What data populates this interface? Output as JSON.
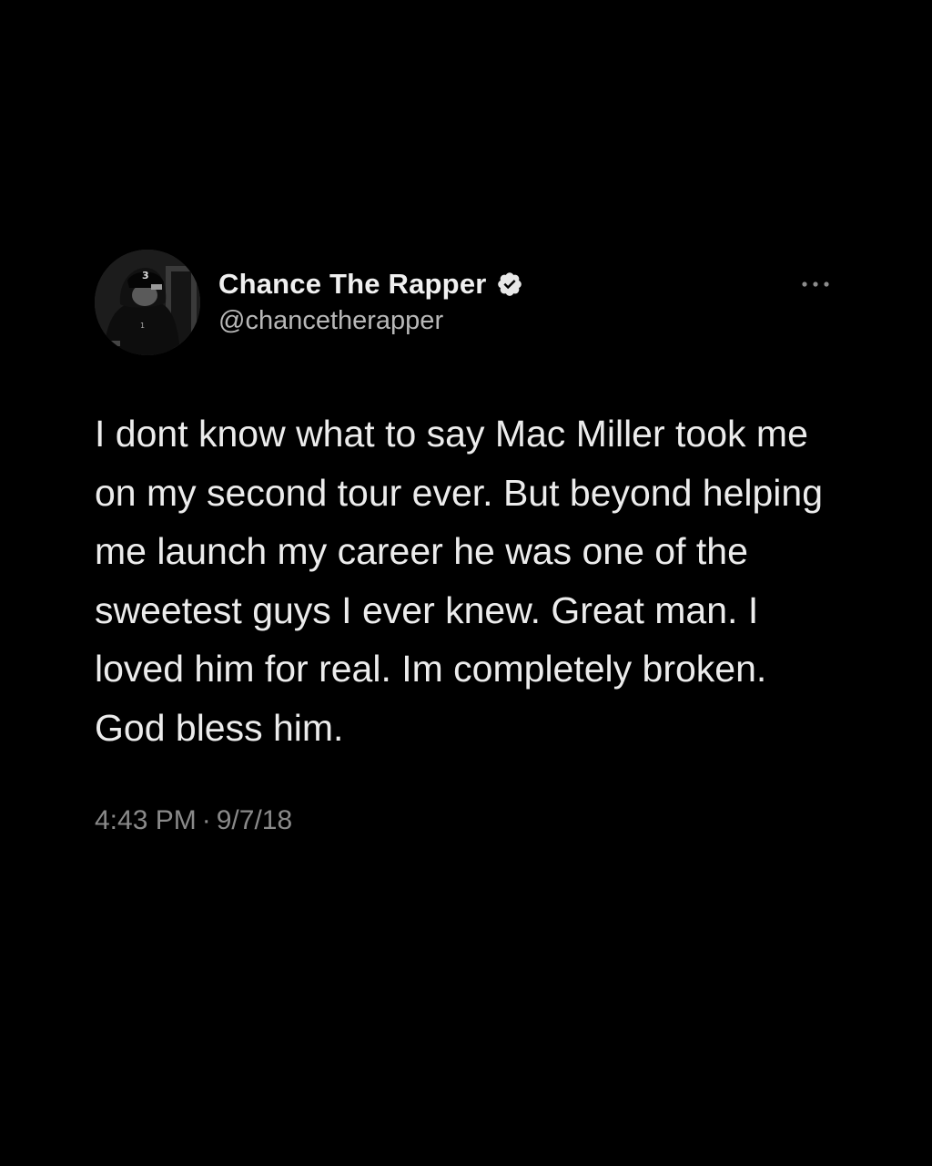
{
  "tweet": {
    "display_name": "Chance The Rapper",
    "handle": "@chancetherapper",
    "verified": true,
    "text": "I dont know what to say Mac Miller took me on my second tour ever. But beyond helping me launch my career he was one of the sweetest guys I ever knew. Great man. I loved him for real. Im completely broken. God bless him.",
    "time": "4:43 PM",
    "separator": "·",
    "date": "9/7/18"
  },
  "icons": {
    "verified": "verified-badge-icon",
    "more": "more-options-icon"
  },
  "colors": {
    "background": "#000000",
    "primary_text": "#ececec",
    "secondary_text": "#b8b8b8",
    "meta_text": "#8a8a8a"
  }
}
